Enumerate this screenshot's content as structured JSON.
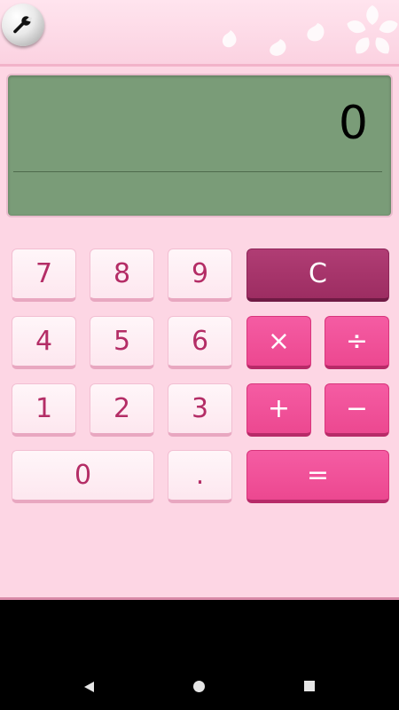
{
  "icons": {
    "settings": "wrench-icon",
    "decoration": "cherry-blossom-petals",
    "nav_back": "back-triangle-icon",
    "nav_home": "home-circle-icon",
    "nav_recent": "recents-square-icon"
  },
  "colors": {
    "background": "#fdd6e4",
    "display": "#7a9c78",
    "number_key_text": "#b42d66",
    "operator_key": "#ef4d95",
    "clear_key": "#a3336a"
  },
  "display": {
    "value": "0"
  },
  "keys": {
    "seven": "7",
    "eight": "8",
    "nine": "9",
    "four": "4",
    "five": "5",
    "six": "6",
    "one": "1",
    "two": "2",
    "three": "3",
    "zero": "0",
    "decimal": ".",
    "clear": "C",
    "multiply": "×",
    "divide": "÷",
    "plus": "+",
    "minus": "−",
    "equals": "="
  }
}
